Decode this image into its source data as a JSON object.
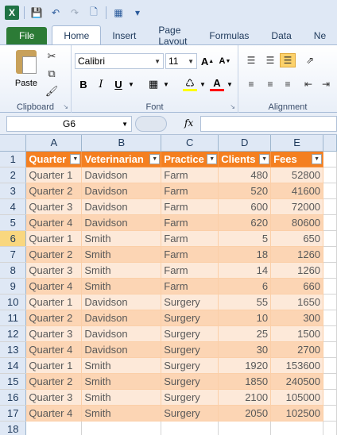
{
  "colors": {
    "accent": "#f47f20",
    "file_tab": "#2c7b36",
    "band_dark": "#fcd5b4",
    "band_light": "#fde9d9"
  },
  "tabs": [
    "File",
    "Home",
    "Insert",
    "Page Layout",
    "Formulas",
    "Data",
    "Ne"
  ],
  "ribbon": {
    "paste_label": "Paste",
    "font_name": "Calibri",
    "font_size": "11",
    "groups": {
      "clipboard": "Clipboard",
      "font": "Font",
      "alignment": "Alignment"
    }
  },
  "name_box": "G6",
  "fx_label": "fx",
  "columns": [
    "A",
    "B",
    "C",
    "D",
    "E"
  ],
  "headers": [
    "Quarter",
    "Veterinarian",
    "Practice",
    "Clients",
    "Fees"
  ],
  "rows": [
    [
      "Quarter 1",
      "Davidson",
      "Farm",
      "480",
      "52800"
    ],
    [
      "Quarter 2",
      "Davidson",
      "Farm",
      "520",
      "41600"
    ],
    [
      "Quarter 3",
      "Davidson",
      "Farm",
      "600",
      "72000"
    ],
    [
      "Quarter 4",
      "Davidson",
      "Farm",
      "620",
      "80600"
    ],
    [
      "Quarter 1",
      "Smith",
      "Farm",
      "5",
      "650"
    ],
    [
      "Quarter 2",
      "Smith",
      "Farm",
      "18",
      "1260"
    ],
    [
      "Quarter 3",
      "Smith",
      "Farm",
      "14",
      "1260"
    ],
    [
      "Quarter 4",
      "Smith",
      "Farm",
      "6",
      "660"
    ],
    [
      "Quarter 1",
      "Davidson",
      "Surgery",
      "55",
      "1650"
    ],
    [
      "Quarter 2",
      "Davidson",
      "Surgery",
      "10",
      "300"
    ],
    [
      "Quarter 3",
      "Davidson",
      "Surgery",
      "25",
      "1500"
    ],
    [
      "Quarter 4",
      "Davidson",
      "Surgery",
      "30",
      "2700"
    ],
    [
      "Quarter 1",
      "Smith",
      "Surgery",
      "1920",
      "153600"
    ],
    [
      "Quarter 2",
      "Smith",
      "Surgery",
      "1850",
      "240500"
    ],
    [
      "Quarter 3",
      "Smith",
      "Surgery",
      "2100",
      "105000"
    ],
    [
      "Quarter 4",
      "Smith",
      "Surgery",
      "2050",
      "102500"
    ]
  ],
  "row_numbers": [
    "1",
    "2",
    "3",
    "4",
    "5",
    "6",
    "7",
    "8",
    "9",
    "10",
    "11",
    "12",
    "13",
    "14",
    "15",
    "16",
    "17",
    "18"
  ],
  "selected_row": "6"
}
